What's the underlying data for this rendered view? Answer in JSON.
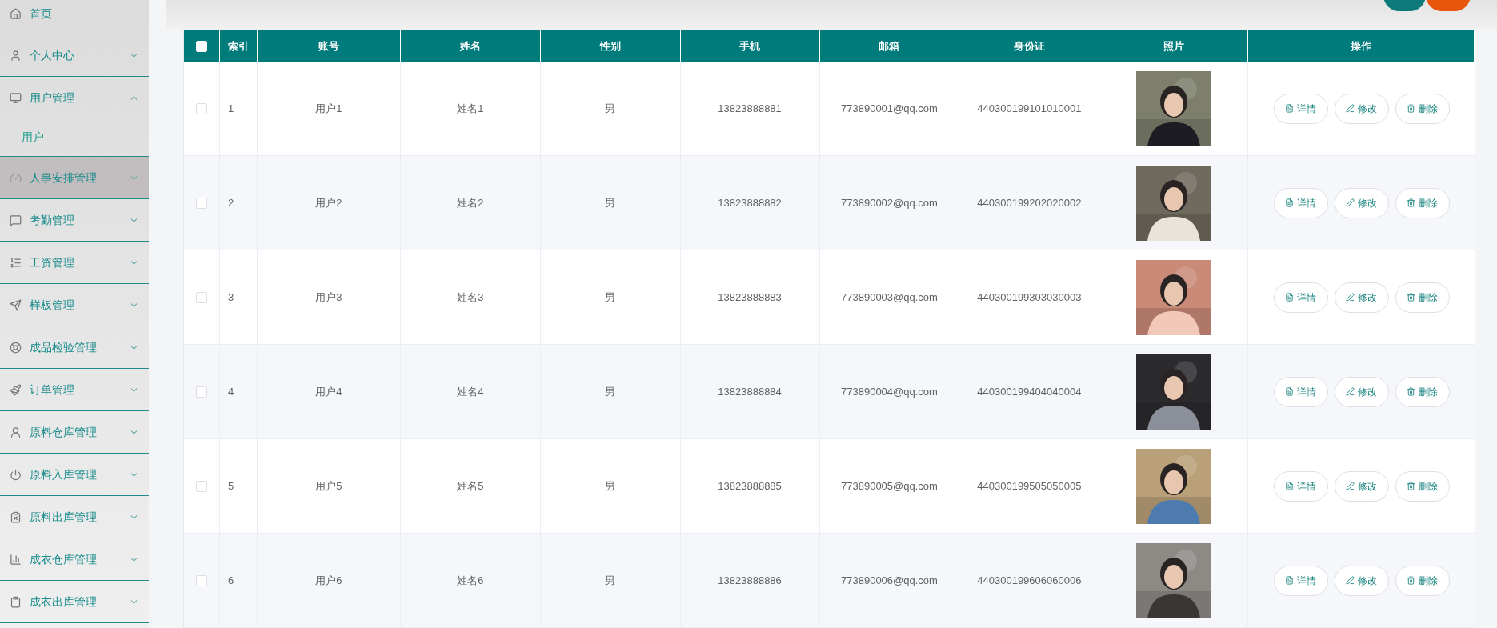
{
  "sidebar": {
    "items": [
      {
        "kind": "link",
        "label": "首页",
        "highlighted": false
      },
      {
        "kind": "menu",
        "label": "个人中心",
        "expanded": false,
        "highlighted": false
      },
      {
        "kind": "menu",
        "label": "用户管理",
        "expanded": true,
        "highlighted": false,
        "children": [
          {
            "label": "用户"
          }
        ]
      },
      {
        "kind": "menu",
        "label": "人事安排管理",
        "expanded": false,
        "highlighted": true
      },
      {
        "kind": "menu",
        "label": "考勤管理",
        "expanded": false,
        "highlighted": false
      },
      {
        "kind": "menu",
        "label": "工资管理",
        "expanded": false,
        "highlighted": false
      },
      {
        "kind": "menu",
        "label": "样板管理",
        "expanded": false,
        "highlighted": false
      },
      {
        "kind": "menu",
        "label": "成品检验管理",
        "expanded": false,
        "highlighted": false
      },
      {
        "kind": "menu",
        "label": "订单管理",
        "expanded": false,
        "highlighted": false
      },
      {
        "kind": "menu",
        "label": "原料仓库管理",
        "expanded": false,
        "highlighted": false
      },
      {
        "kind": "menu",
        "label": "原料入库管理",
        "expanded": false,
        "highlighted": false
      },
      {
        "kind": "menu",
        "label": "原料出库管理",
        "expanded": false,
        "highlighted": false
      },
      {
        "kind": "menu",
        "label": "成衣仓库管理",
        "expanded": false,
        "highlighted": false
      },
      {
        "kind": "menu",
        "label": "成衣出库管理",
        "expanded": false,
        "highlighted": false
      }
    ]
  },
  "table": {
    "select_all": {
      "checked": false
    },
    "columns": [
      "索引",
      "账号",
      "姓名",
      "性别",
      "手机",
      "邮箱",
      "身份证",
      "照片",
      "操作"
    ],
    "rows": [
      {
        "checked": false,
        "index": "1",
        "account": "用户1",
        "name": "姓名1",
        "gender": "男",
        "phone": "13823888881",
        "email": "773890001@qq.com",
        "id_card": "440300199101010001",
        "actions": [
          "详情",
          "修改",
          "删除"
        ]
      },
      {
        "checked": false,
        "index": "2",
        "account": "用户2",
        "name": "姓名2",
        "gender": "男",
        "phone": "13823888882",
        "email": "773890002@qq.com",
        "id_card": "440300199202020002",
        "actions": [
          "详情",
          "修改",
          "删除"
        ]
      },
      {
        "checked": false,
        "index": "3",
        "account": "用户3",
        "name": "姓名3",
        "gender": "男",
        "phone": "13823888883",
        "email": "773890003@qq.com",
        "id_card": "440300199303030003",
        "actions": [
          "详情",
          "修改",
          "删除"
        ]
      },
      {
        "checked": false,
        "index": "4",
        "account": "用户4",
        "name": "姓名4",
        "gender": "男",
        "phone": "13823888884",
        "email": "773890004@qq.com",
        "id_card": "440300199404040004",
        "actions": [
          "详情",
          "修改",
          "删除"
        ]
      },
      {
        "checked": false,
        "index": "5",
        "account": "用户5",
        "name": "姓名5",
        "gender": "男",
        "phone": "13823888885",
        "email": "773890005@qq.com",
        "id_card": "440300199505050005",
        "actions": [
          "详情",
          "修改",
          "删除"
        ]
      },
      {
        "checked": false,
        "index": "6",
        "account": "用户6",
        "name": "姓名6",
        "gender": "男",
        "phone": "13823888886",
        "email": "773890006@qq.com",
        "id_card": "440300199606060006",
        "actions": [
          "详情",
          "修改",
          "删除"
        ]
      }
    ]
  }
}
